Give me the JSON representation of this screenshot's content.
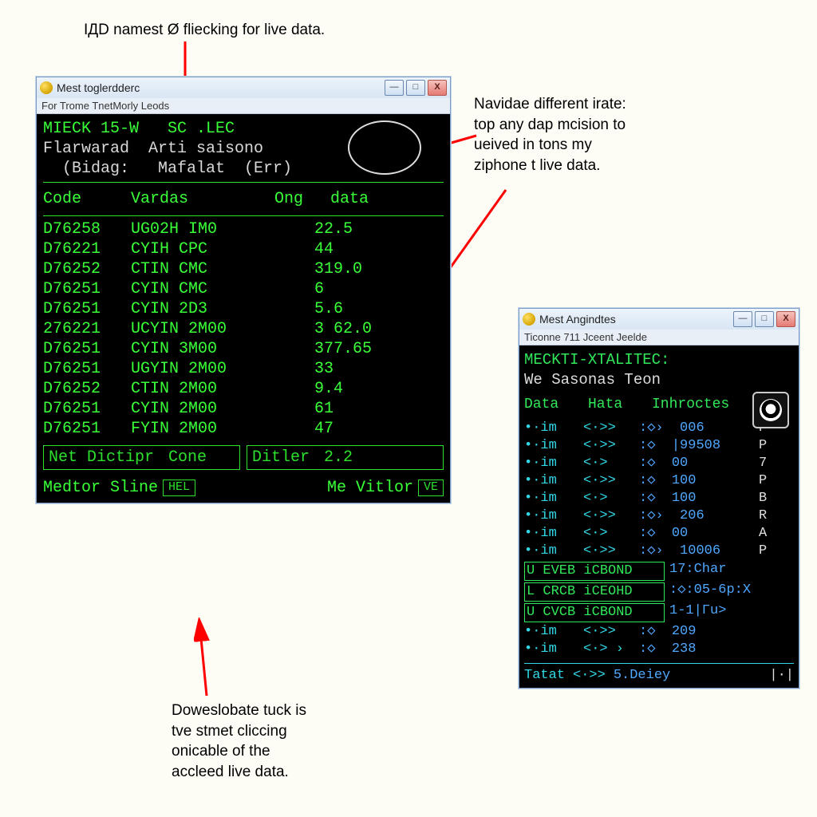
{
  "annotations": {
    "top": "IДD namest Ø fliecking for live  data.",
    "right": "Navidae different irate:\ntop any dap mcision to\nueived in tons my\nziphone t live data.",
    "bottom": "Doweslobate tuck is\ntve stmet cliccing\nonicable of the\naccleed live data."
  },
  "window1": {
    "title": "Mest toglerdderc",
    "menu": "For  Trome  TnetMorly  Leods",
    "header1": "MIECK 15-W   SC .LEC",
    "header2": "Flarwarad  Arti saisono",
    "header3": "  (Bidag:   Mafalat  (Err)",
    "cols": [
      "Code",
      "Vardas",
      "Ong",
      "data"
    ],
    "rows": [
      {
        "c": "D76258",
        "v": "UG02H IM0",
        "d": "22.5"
      },
      {
        "c": "D76221",
        "v": "CYIH CPC",
        "d": "44"
      },
      {
        "c": "D76252",
        "v": "CTIN CMC",
        "d": "319.0"
      },
      {
        "c": "D76251",
        "v": "CYIN CMC",
        "d": "6"
      },
      {
        "c": "D76251",
        "v": "CYIN 2D3",
        "d": "5.6"
      },
      {
        "c": "276221",
        "v": "UCYIN 2M00",
        "d": "3 62.0"
      },
      {
        "c": "D76251",
        "v": "CYIN 3M00",
        "d": "377.65"
      },
      {
        "c": "D76251",
        "v": "UGYIN 2M00",
        "d": "33"
      },
      {
        "c": "D76252",
        "v": "CTIN 2M00",
        "d": "9.4"
      },
      {
        "c": "D76251",
        "v": "CYIN 2M00",
        "d": "61"
      },
      {
        "c": "D76251",
        "v": "FYIN 2M00",
        "d": "47"
      }
    ],
    "boxLeft": {
      "a": "Net Dictipr",
      "b": "Cone"
    },
    "boxRight": {
      "a": "Ditler",
      "b": "2.2"
    },
    "footerLeft": "Medtor Sline",
    "footerLeftBtn": "HEL",
    "footerRight": "Me Vitlor",
    "footerRightBtn": "VE"
  },
  "window2": {
    "title": "Mest Angindtes",
    "menu": "Ticonne  711 Jceent  Jeelde",
    "header1": "MECKTI-XTALITEC:",
    "header2": "We Sasonas Teon",
    "cols": [
      "Data",
      "Hata",
      "Inhroctes"
    ],
    "rows": [
      {
        "a": "•·im",
        "b": "<·>>",
        "c": ":◇›  006",
        "e": "P"
      },
      {
        "a": "•·im",
        "b": "<·>>",
        "c": ":◇  |99508",
        "e": "P"
      },
      {
        "a": "•·im",
        "b": "<·>",
        "c": ":◇  00",
        "e": "7"
      },
      {
        "a": "•·im",
        "b": "<·>>",
        "c": ":◇  100",
        "e": "P"
      },
      {
        "a": "•·im",
        "b": "<·>",
        "c": ":◇  100",
        "e": "B"
      },
      {
        "a": "•·im",
        "b": "<·>>",
        "c": ":◇›  206",
        "e": "R"
      },
      {
        "a": "•·im",
        "b": "<·>",
        "c": ":◇  00",
        "e": "A"
      },
      {
        "a": "•·im",
        "b": "<·>>",
        "c": ":◇›  10006",
        "e": "P"
      }
    ],
    "greenRows": [
      {
        "a": "U EVEB iCBOND",
        "b": "17:Char"
      },
      {
        "a": "L CRCB iCEOHD",
        "b": ":◇:05-6p:X"
      },
      {
        "a": "U CVCB iCBOND",
        "b": "1-1|Гu>"
      }
    ],
    "rows2": [
      {
        "a": "•·im",
        "b": "<·>>",
        "c": ":◇  209"
      },
      {
        "a": "•·im",
        "b": "<·> ›",
        "c": ":◇  238"
      }
    ],
    "footer": {
      "a": "Tatat",
      "b": "<·>>",
      "c": "5.Deiey",
      "d": "|·|"
    }
  }
}
